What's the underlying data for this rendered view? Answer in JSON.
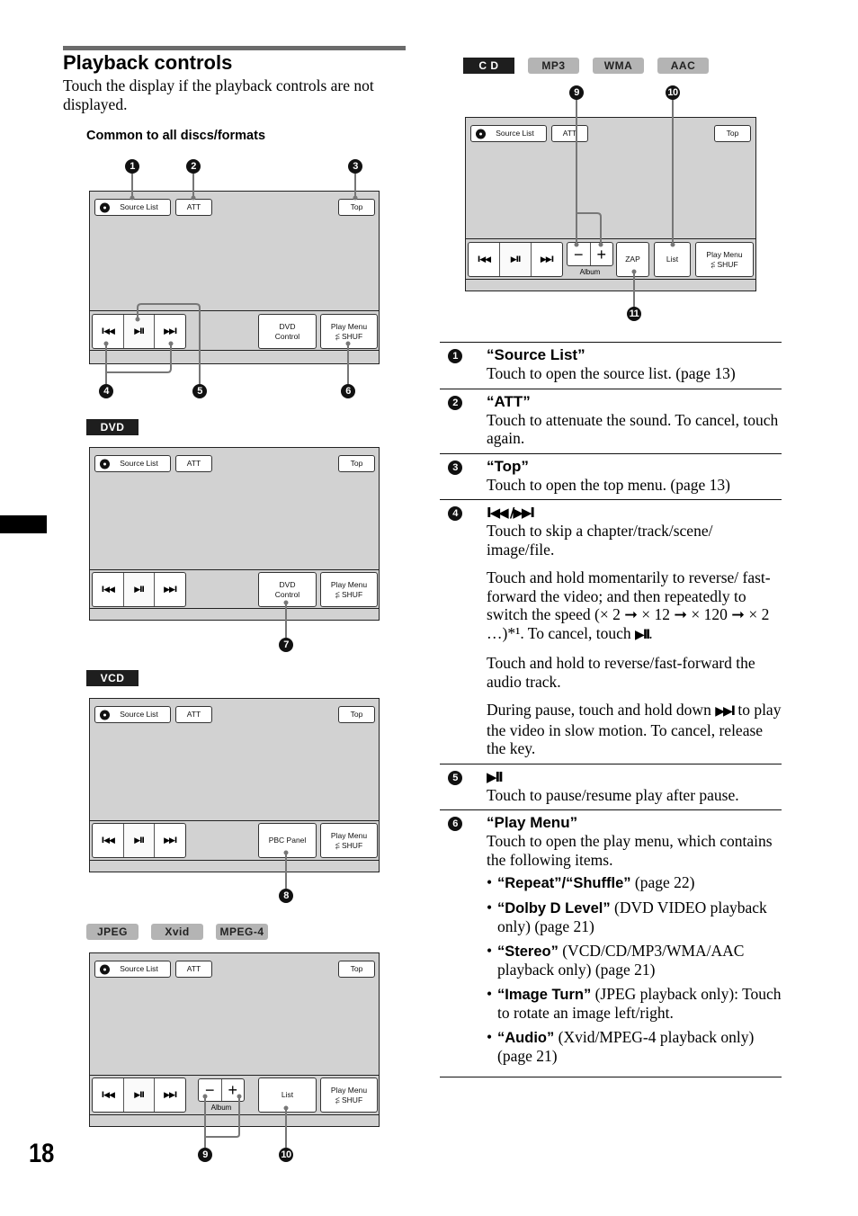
{
  "page": {
    "title": "Playback controls",
    "intro": "Touch the display if the playback controls are not displayed.",
    "common_heading": "Common to all discs/formats",
    "page_number": "18"
  },
  "badges": {
    "dvd": "DVD",
    "vcd": "VCD",
    "jpeg": "JPEG",
    "xvid": "Xvid",
    "mpeg4": "MPEG-4",
    "cd": "C D",
    "mp3": "MP3",
    "wma": "WMA",
    "aac": "AAC"
  },
  "screen_labels": {
    "source_list": "Source List",
    "att": "ATT",
    "top": "Top",
    "prev": "I◀◀",
    "play_pause": "▶II",
    "next": "▶▶I",
    "dvd_control_1": "DVD",
    "dvd_control_2": "Control",
    "play_menu_1": "Play Menu",
    "play_menu_2": "⥶ SHUF",
    "pbc_panel": "PBC Panel",
    "list": "List",
    "zap": "ZAP",
    "album": "Album",
    "minus": "−",
    "plus": "+"
  },
  "callouts": {
    "c1": "1",
    "c2": "2",
    "c3": "3",
    "c4": "4",
    "c5": "5",
    "c6": "6",
    "c7": "7",
    "c8": "8",
    "c9": "9",
    "c10": "10",
    "c11": "11"
  },
  "descriptions": [
    {
      "num": "1",
      "title": "“Source List”",
      "paragraphs": [
        "Touch to open the source list. (page 13)"
      ]
    },
    {
      "num": "2",
      "title": "“ATT”",
      "paragraphs": [
        "Touch to attenuate the sound. To cancel, touch again."
      ]
    },
    {
      "num": "3",
      "title": "“Top”",
      "paragraphs": [
        "Touch to open the top menu. (page 13)"
      ]
    },
    {
      "num": "4",
      "title": "I◀◀ /▶▶I",
      "paragraphs": [
        "Touch to skip a chapter/track/scene/ image/file.",
        "Touch and hold momentarily to reverse/ fast-forward the video; and then repeatedly to switch the speed (× 2 ➞ × 12 ➞ × 120 ➞ × 2 …)*¹. To cancel, touch",
        "Touch and hold to reverse/fast-forward the audio track.",
        "During pause, touch and hold down",
        "to play the video in slow motion. To cancel, release the key."
      ],
      "inline_symbols": {
        "play_pause": "▶II",
        "next": "▶▶I"
      }
    },
    {
      "num": "5",
      "title": "▶II",
      "paragraphs": [
        "Touch to pause/resume play after pause."
      ]
    },
    {
      "num": "6",
      "title": "“Play Menu”",
      "paragraphs": [
        "Touch to open the play menu, which contains the following items."
      ],
      "items": [
        {
          "label": "“Repeat”/“Shuffle”",
          "text": " (page 22)"
        },
        {
          "label": "“Dolby D Level”",
          "text": " (DVD VIDEO playback only) (page 21)"
        },
        {
          "label": "“Stereo”",
          "text": " (VCD/CD/MP3/WMA/AAC playback only) (page 21)"
        },
        {
          "label": "“Image Turn”",
          "text": " (JPEG playback only): Touch to rotate an image left/right."
        },
        {
          "label": "“Audio”",
          "text": " (Xvid/MPEG-4 playback only) (page 21)"
        }
      ]
    }
  ]
}
